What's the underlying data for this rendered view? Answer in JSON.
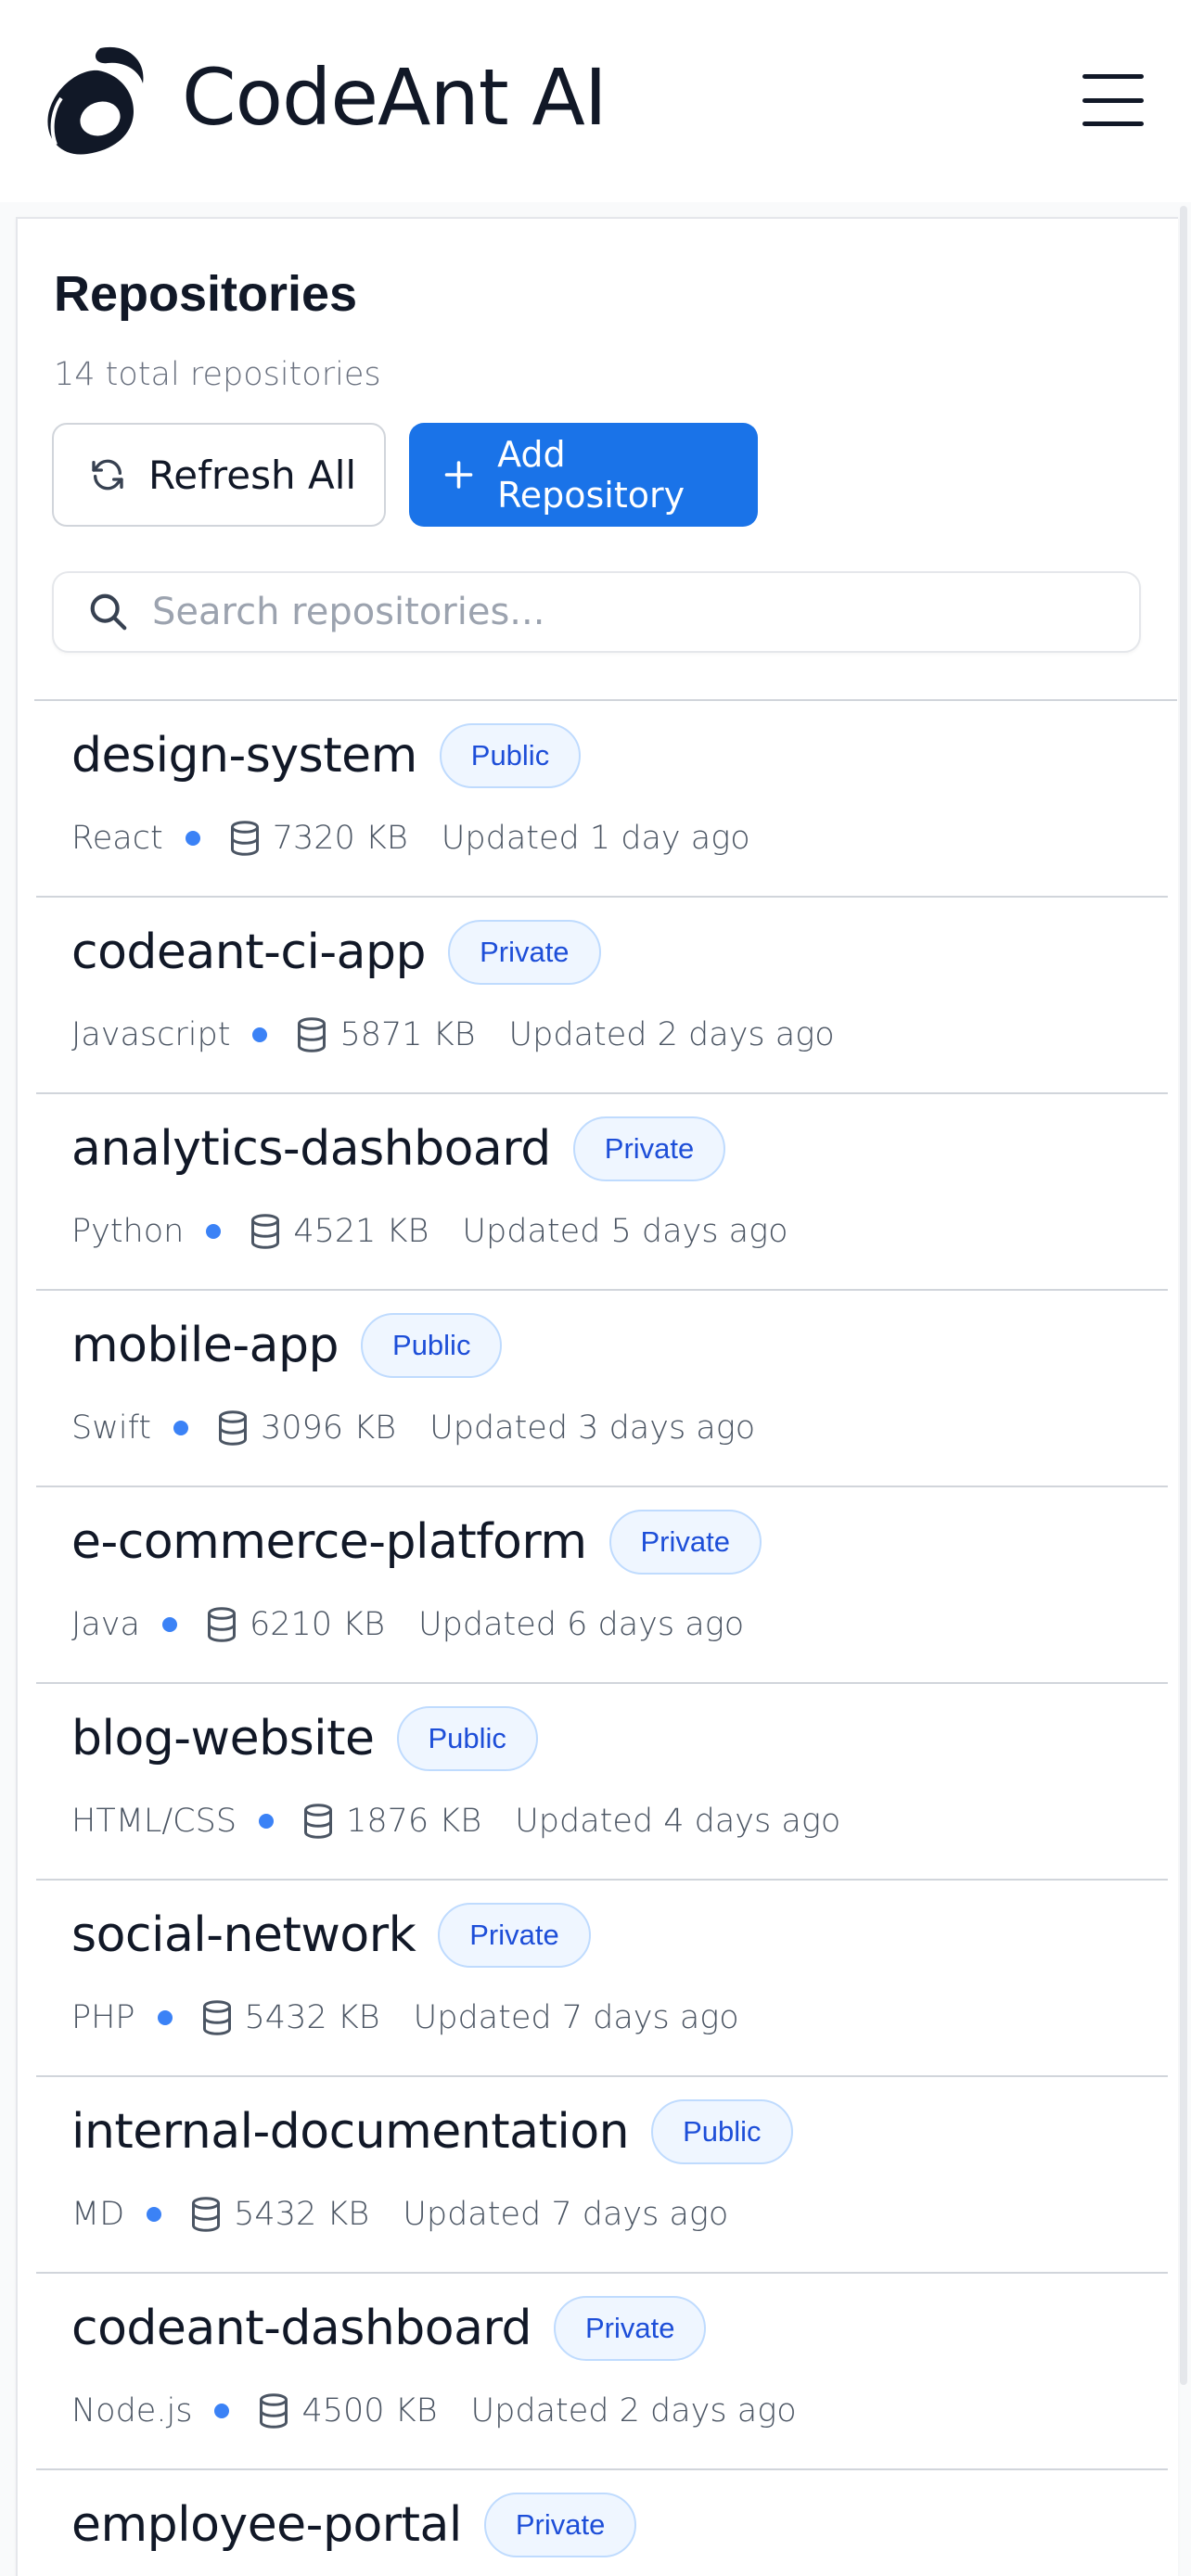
{
  "app": {
    "brand": "CodeAnt AI",
    "menu_icon": "hamburger-menu-icon"
  },
  "page": {
    "title": "Repositories",
    "subtitle": "14 total repositories",
    "refresh_label": "Refresh All",
    "add_label": "Add Repository",
    "search_placeholder": "Search repositories..."
  },
  "colors": {
    "primary": "#1a73e8",
    "badge_bg": "#eff6ff",
    "badge_text": "#1d4ed8",
    "language_dot": "#3b82f6"
  },
  "repositories": [
    {
      "name": "design-system",
      "visibility": "Public",
      "language": "React",
      "size": "7320 KB",
      "updated": "Updated 1 day ago"
    },
    {
      "name": "codeant-ci-app",
      "visibility": "Private",
      "language": "Javascript",
      "size": "5871 KB",
      "updated": "Updated 2 days ago"
    },
    {
      "name": "analytics-dashboard",
      "visibility": "Private",
      "language": "Python",
      "size": "4521 KB",
      "updated": "Updated 5 days ago"
    },
    {
      "name": "mobile-app",
      "visibility": "Public",
      "language": "Swift",
      "size": "3096 KB",
      "updated": "Updated 3 days ago"
    },
    {
      "name": "e-commerce-platform",
      "visibility": "Private",
      "language": "Java",
      "size": "6210 KB",
      "updated": "Updated 6 days ago"
    },
    {
      "name": "blog-website",
      "visibility": "Public",
      "language": "HTML/CSS",
      "size": "1876 KB",
      "updated": "Updated 4 days ago"
    },
    {
      "name": "social-network",
      "visibility": "Private",
      "language": "PHP",
      "size": "5432 KB",
      "updated": "Updated 7 days ago"
    },
    {
      "name": "internal-documentation",
      "visibility": "Public",
      "language": "MD",
      "size": "5432 KB",
      "updated": "Updated 7 days ago"
    },
    {
      "name": "codeant-dashboard",
      "visibility": "Private",
      "language": "Node.js",
      "size": "4500 KB",
      "updated": "Updated 2 days ago"
    },
    {
      "name": "employee-portal",
      "visibility": "Private",
      "language": "",
      "size": "",
      "updated": ""
    }
  ]
}
